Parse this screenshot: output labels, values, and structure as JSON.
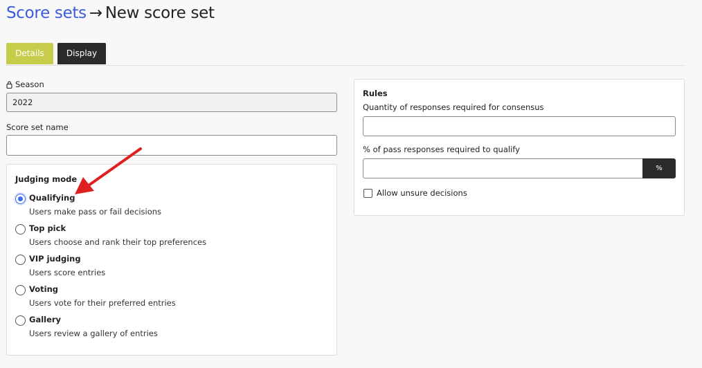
{
  "breadcrumb": {
    "parent": "Score sets",
    "separator": "→",
    "current": "New score set"
  },
  "tabs": [
    {
      "label": "Details",
      "active": true
    },
    {
      "label": "Display",
      "active": false
    }
  ],
  "form": {
    "season": {
      "label": "Season",
      "value": "2022",
      "locked": true
    },
    "score_set_name": {
      "label": "Score set name",
      "value": ""
    }
  },
  "judging_mode": {
    "title": "Judging mode",
    "options": [
      {
        "title": "Qualifying",
        "description": "Users make pass or fail decisions",
        "selected": true
      },
      {
        "title": "Top pick",
        "description": "Users choose and rank their top preferences",
        "selected": false
      },
      {
        "title": "VIP judging",
        "description": "Users score entries",
        "selected": false
      },
      {
        "title": "Voting",
        "description": "Users vote for their preferred entries",
        "selected": false
      },
      {
        "title": "Gallery",
        "description": "Users review a gallery of entries",
        "selected": false
      }
    ]
  },
  "rules": {
    "title": "Rules",
    "consensus_label": "Quantity of responses required for consensus",
    "consensus_value": "",
    "pass_label": "% of pass responses required to qualify",
    "pass_value": "",
    "pass_suffix": "%",
    "allow_unsure_label": "Allow unsure decisions",
    "allow_unsure_checked": false
  },
  "colors": {
    "link": "#3d5bd9",
    "tab_active": "#c7cc4c",
    "tab_inactive": "#2b2b2b",
    "radio_selected": "#3d6df0",
    "annotation_arrow": "#e02020"
  }
}
